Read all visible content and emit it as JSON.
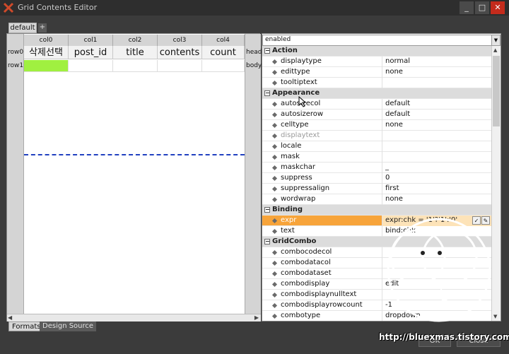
{
  "window": {
    "title": "Grid Contents Editor",
    "minimize": "_",
    "maximize": "□",
    "close": "✕"
  },
  "tabs": {
    "active": "default",
    "add": "+"
  },
  "grid": {
    "columns": [
      "col0",
      "col1",
      "col2",
      "col3",
      "col4"
    ],
    "head_label": "head",
    "body_label": "body",
    "row0_label": "row0",
    "row1_label": "row1",
    "header_cells": [
      "삭제선택",
      "post_id",
      "title",
      "contents",
      "count"
    ],
    "body_first_cell_color": "#a0f040"
  },
  "bottom_tabs": {
    "formats": "Formats",
    "design_source": "Design Source"
  },
  "properties": {
    "combo_value": "enabled",
    "categories": [
      {
        "name": "Action",
        "items": [
          {
            "name": "displaytype",
            "value": "normal"
          },
          {
            "name": "edittype",
            "value": "none"
          },
          {
            "name": "tooltiptext",
            "value": ""
          }
        ]
      },
      {
        "name": "Appearance",
        "items": [
          {
            "name": "autosizecol",
            "value": "default"
          },
          {
            "name": "autosizerow",
            "value": "default"
          },
          {
            "name": "celltype",
            "value": "none"
          },
          {
            "name": "displaytext",
            "value": "",
            "dim": true
          },
          {
            "name": "locale",
            "value": ""
          },
          {
            "name": "mask",
            "value": ""
          },
          {
            "name": "maskchar",
            "value": "_"
          },
          {
            "name": "suppress",
            "value": "0"
          },
          {
            "name": "suppressalign",
            "value": "first"
          },
          {
            "name": "wordwrap",
            "value": "none"
          }
        ]
      },
      {
        "name": "Binding",
        "items": [
          {
            "name": "expr",
            "value": "expr:chk = '1'?'1':'0'",
            "selected": true
          },
          {
            "name": "text",
            "value": "bind:chk"
          }
        ]
      },
      {
        "name": "GridCombo",
        "items": [
          {
            "name": "combocodecol",
            "value": ""
          },
          {
            "name": "combodatacol",
            "value": ""
          },
          {
            "name": "combodataset",
            "value": ""
          },
          {
            "name": "combodisplay",
            "value": "edit"
          },
          {
            "name": "combodisplaynulltext",
            "value": ""
          },
          {
            "name": "combodisplayrowcount",
            "value": "-1"
          },
          {
            "name": "combotype",
            "value": "dropdown"
          }
        ]
      }
    ]
  },
  "buttons": {
    "ok": "OK",
    "close": "Close"
  },
  "watermark": "http://bluexmas.tistory.com/"
}
